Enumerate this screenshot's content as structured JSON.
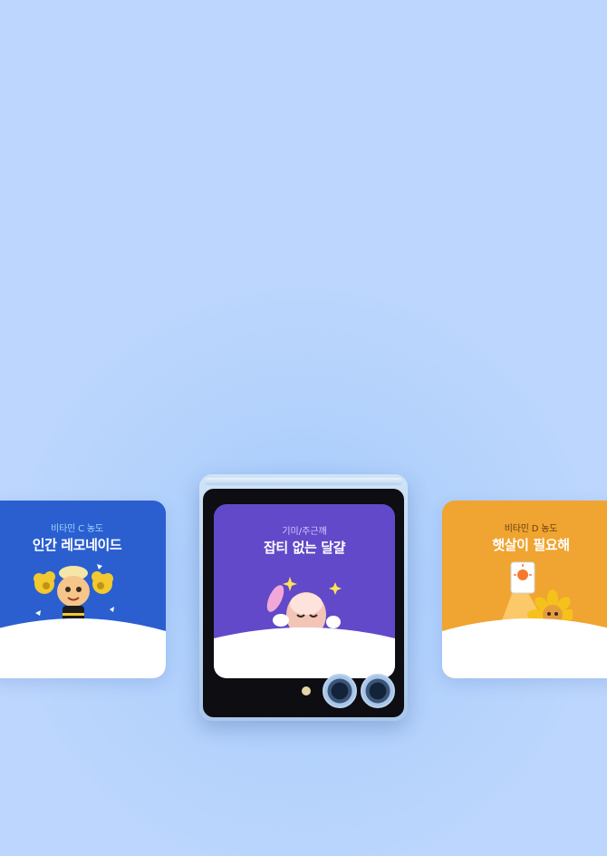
{
  "cards": {
    "left": {
      "subtitle": "비타민 C 농도",
      "title": "인간 레모네이드",
      "color": "#2b5fd0"
    },
    "center": {
      "subtitle": "기미/주근깨",
      "title": "잡티 없는 달걀",
      "color": "#6149c9"
    },
    "right": {
      "subtitle": "비타민 D 농도",
      "title": "햇살이 필요해",
      "color": "#f0a431"
    }
  },
  "icons": [
    "cheerleader-lemon-character",
    "egg-character-icon",
    "sunflower-character",
    "sparkle-icon"
  ]
}
